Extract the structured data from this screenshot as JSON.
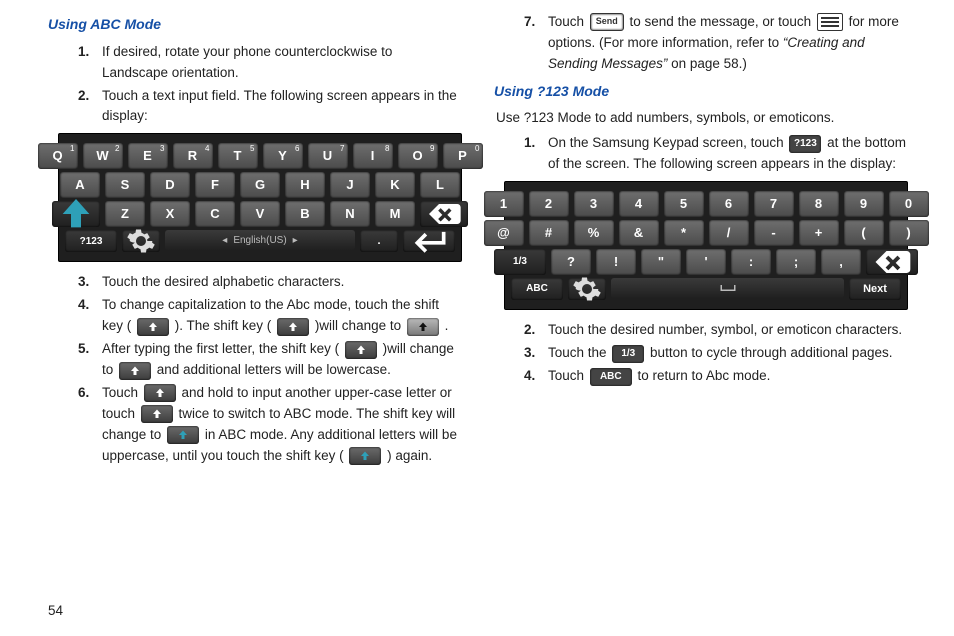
{
  "page_number": "54",
  "left": {
    "heading1": "Using ABC Mode",
    "step1": "If desired, rotate your phone counterclockwise to Landscape orientation.",
    "step2": "Touch a text input field. The following screen appears in the display:",
    "step3": "Touch the desired alphabetic characters.",
    "step4_a": "To change capitalization to the Abc mode, touch the shift key ( ",
    "step4_b": " ). The shift key ( ",
    "step4_c": " )will change to ",
    "step4_d": " .",
    "step5_a": "After typing the first letter, the shift key ( ",
    "step5_b": " )will change to ",
    "step5_c": " and additional letters will be lowercase.",
    "step6_a": "Touch ",
    "step6_b": " and hold to input another upper-case letter or touch ",
    "step6_c": " twice to switch to ABC mode. The shift key will change to ",
    "step6_d": " in ABC mode. Any additional letters will be uppercase, until you touch the shift key ( ",
    "step6_e": " ) again."
  },
  "right": {
    "step7_a": "Touch ",
    "step7_b": " to send the message, or touch ",
    "step7_c": " for more options. (For more information, refer to ",
    "step7_ref": "“Creating and Sending Messages”",
    "step7_d": "  on page 58.)",
    "heading2": "Using ?123 Mode",
    "lead": "Use ?123 Mode to add numbers, symbols, or emoticons.",
    "r1_a": "On the Samsung Keypad screen, touch ",
    "r1_b": " at the bottom of the screen. The following screen appears in the display:",
    "r2": "Touch the desired number, symbol, or emoticon characters.",
    "r3_a": "Touch the ",
    "r3_b": " button to cycle through additional pages.",
    "r4_a": "Touch ",
    "r4_b": " to return to Abc mode."
  },
  "chips": {
    "send": "Send",
    "q123": "?123",
    "one_three": "1/3",
    "abc": "ABC",
    "next": "Next"
  },
  "kb_abc": {
    "row1": [
      "Q",
      "W",
      "E",
      "R",
      "T",
      "Y",
      "U",
      "I",
      "O",
      "P"
    ],
    "row1_sup": [
      "1",
      "2",
      "3",
      "4",
      "5",
      "6",
      "7",
      "8",
      "9",
      "0"
    ],
    "row2": [
      "A",
      "S",
      "D",
      "F",
      "G",
      "H",
      "J",
      "K",
      "L"
    ],
    "row3": [
      "Z",
      "X",
      "C",
      "V",
      "B",
      "N",
      "M"
    ],
    "bottom_left": "?123",
    "dot": ".",
    "space_label": "English(US)"
  },
  "kb_num": {
    "row1": [
      "1",
      "2",
      "3",
      "4",
      "5",
      "6",
      "7",
      "8",
      "9",
      "0"
    ],
    "row2": [
      "@",
      "#",
      "%",
      "&",
      "*",
      "/",
      "-",
      "+",
      "(",
      ")"
    ],
    "row3_left": "1/3",
    "row3": [
      "?",
      "!",
      "\"",
      "'",
      ":",
      ";",
      ","
    ],
    "bottom_left": "ABC"
  }
}
